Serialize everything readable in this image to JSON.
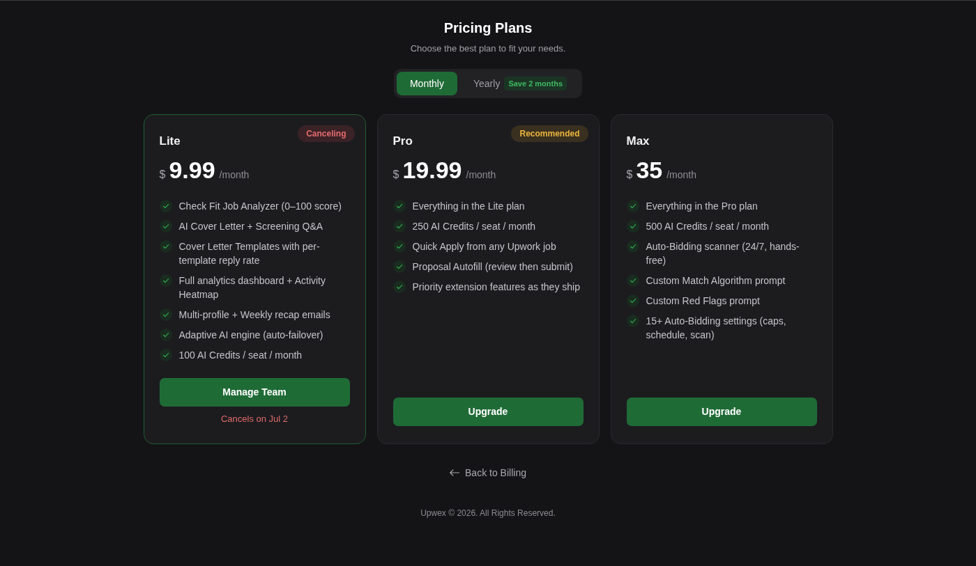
{
  "header": {
    "title": "Pricing Plans",
    "subtitle": "Choose the best plan to fit your needs."
  },
  "billing_toggle": [
    {
      "label": "Monthly",
      "selected": true
    },
    {
      "label": "Yearly",
      "selected": false,
      "badge": "Save 2 months"
    }
  ],
  "plans": [
    {
      "name": "Lite",
      "current": true,
      "badge": {
        "text": "Canceling",
        "kind": "danger"
      },
      "currency": "$",
      "price": "9.99",
      "period": "/month",
      "features": [
        "Check Fit Job Analyzer (0–100 score)",
        "AI Cover Letter + Screening Q&A",
        "Cover Letter Templates with per-template reply rate",
        "Full analytics dashboard + Activity Heatmap",
        "Multi-profile + Weekly recap emails",
        "Adaptive AI engine (auto-failover)",
        "100 AI Credits / seat / month"
      ],
      "button": "Manage Team",
      "note": "Cancels on Jul 2"
    },
    {
      "name": "Pro",
      "current": false,
      "badge": {
        "text": "Recommended",
        "kind": "warning"
      },
      "currency": "$",
      "price": "19.99",
      "period": "/month",
      "features": [
        "Everything in the Lite plan",
        "250 AI Credits / seat / month",
        "Quick Apply from any Upwork job",
        "Proposal Autofill (review then submit)",
        "Priority extension features as they ship"
      ],
      "button": "Upgrade"
    },
    {
      "name": "Max",
      "current": false,
      "currency": "$",
      "price": "35",
      "period": "/month",
      "features": [
        "Everything in the Pro plan",
        "500 AI Credits / seat / month",
        "Auto-Bidding scanner (24/7, hands-free)",
        "Custom Match Algorithm prompt",
        "Custom Red Flags prompt",
        "15+ Auto-Bidding settings (caps, schedule, scan)"
      ],
      "button": "Upgrade"
    }
  ],
  "back_link": "Back to Billing",
  "footer": "Upwex © 2026. All Rights Reserved."
}
